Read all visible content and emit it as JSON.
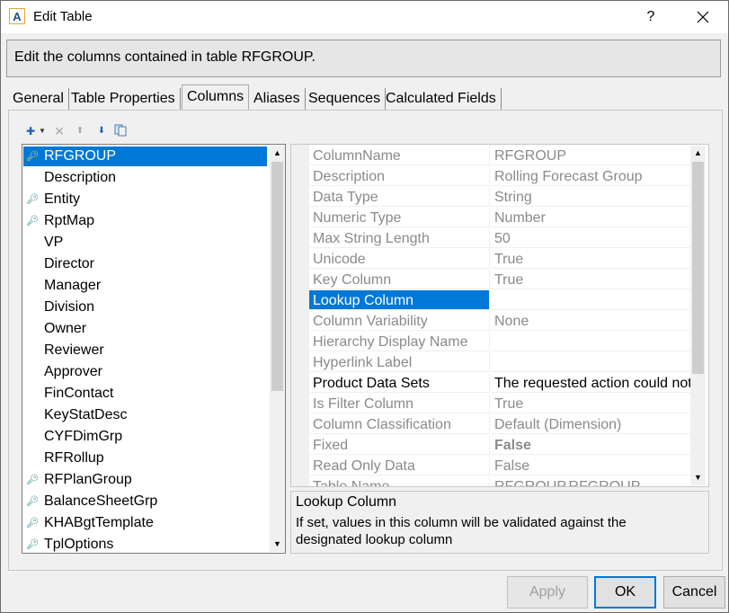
{
  "window": {
    "title": "Edit Table",
    "app_icon_letter": "A",
    "help_label": "?",
    "close_icon": "close-icon"
  },
  "header": {
    "text": "Edit the columns contained in table RFGROUP."
  },
  "tabs": [
    {
      "label": "General",
      "active": false
    },
    {
      "label": "Table Properties",
      "active": false
    },
    {
      "label": "Columns",
      "active": true
    },
    {
      "label": "Aliases",
      "active": false
    },
    {
      "label": "Sequences",
      "active": false
    },
    {
      "label": "Calculated Fields",
      "active": false
    }
  ],
  "toolbar": {
    "add_icon": "add-icon",
    "delete_icon": "delete-icon",
    "move_up_icon": "move-up-icon",
    "move_down_icon": "move-down-icon",
    "copy_icon": "copy-icon"
  },
  "columns_list": {
    "selected": "RFGROUP",
    "items": [
      {
        "label": "RFGROUP",
        "key": true,
        "selected": true
      },
      {
        "label": "Description",
        "key": false
      },
      {
        "label": "Entity",
        "key": true
      },
      {
        "label": "RptMap",
        "key": true
      },
      {
        "label": "VP",
        "key": false
      },
      {
        "label": "Director",
        "key": false
      },
      {
        "label": "Manager",
        "key": false
      },
      {
        "label": "Division",
        "key": false
      },
      {
        "label": "Owner",
        "key": false
      },
      {
        "label": "Reviewer",
        "key": false
      },
      {
        "label": "Approver",
        "key": false
      },
      {
        "label": "FinContact",
        "key": false
      },
      {
        "label": "KeyStatDesc",
        "key": false
      },
      {
        "label": "CYFDimGrp",
        "key": false
      },
      {
        "label": "RFRollup",
        "key": false
      },
      {
        "label": "RFPlanGroup",
        "key": true
      },
      {
        "label": "BalanceSheetGrp",
        "key": true
      },
      {
        "label": "KHABgtTemplate",
        "key": true
      },
      {
        "label": "TplOptions",
        "key": true
      }
    ]
  },
  "properties": [
    {
      "name": "ColumnName",
      "value": "RFGROUP"
    },
    {
      "name": "Description",
      "value": "Rolling Forecast Group"
    },
    {
      "name": "Data Type",
      "value": "String"
    },
    {
      "name": "Numeric Type",
      "value": "Number"
    },
    {
      "name": "Max String Length",
      "value": "50"
    },
    {
      "name": "Unicode",
      "value": "True"
    },
    {
      "name": "Key Column",
      "value": "True"
    },
    {
      "name": "Lookup Column",
      "value": "",
      "selected": true
    },
    {
      "name": "Column Variability",
      "value": "None"
    },
    {
      "name": "Hierarchy Display Name",
      "value": ""
    },
    {
      "name": "Hyperlink Label",
      "value": ""
    },
    {
      "name": "Product Data Sets",
      "value": "The requested action could not",
      "dark": true
    },
    {
      "name": "Is Filter Column",
      "value": "True"
    },
    {
      "name": "Column Classification",
      "value": "Default (Dimension)"
    },
    {
      "name": "Fixed",
      "value": "False",
      "bold": true
    },
    {
      "name": "Read Only Data",
      "value": "False"
    },
    {
      "name": "Table Name",
      "value": "RFGROUP.RFGROUP"
    }
  ],
  "description_panel": {
    "title": "Lookup Column",
    "text": "If set, values in this column will be validated against the designated lookup column"
  },
  "buttons": {
    "apply": "Apply",
    "ok": "OK",
    "cancel": "Cancel"
  },
  "colors": {
    "selection": "#0078d7",
    "key_icon_selected": "#f7d448",
    "key_icon": "#2e8b8b"
  }
}
